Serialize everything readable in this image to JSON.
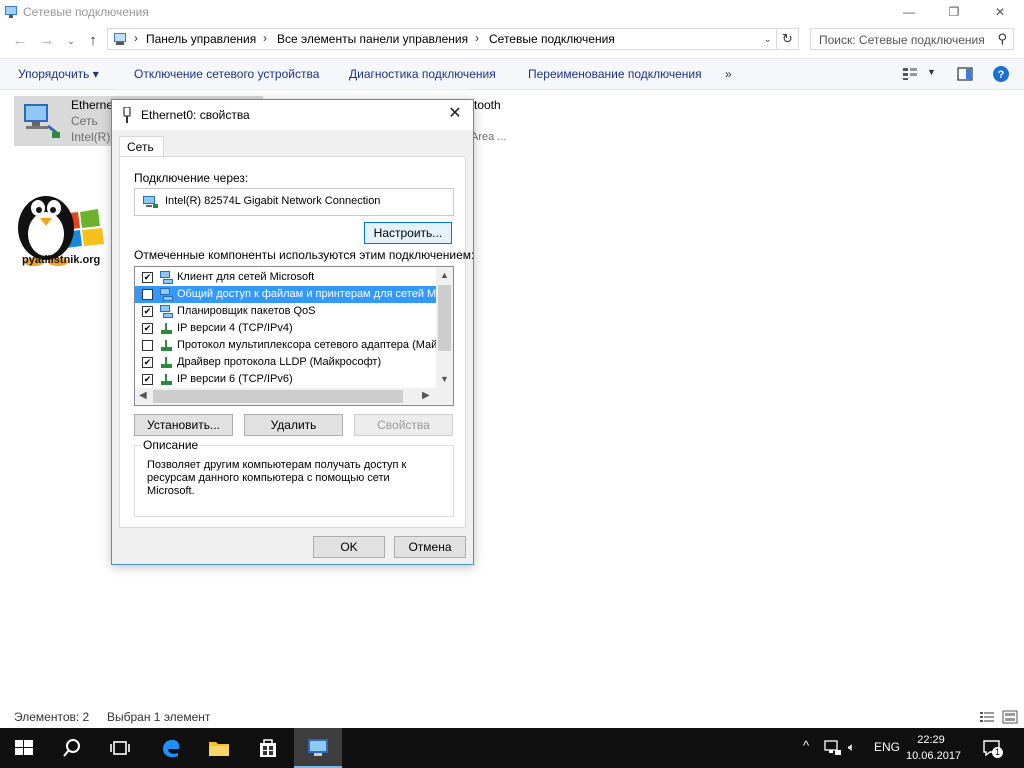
{
  "window": {
    "title": "Сетевые подключения",
    "minimize": "—",
    "maximize": "❐",
    "close": "✕"
  },
  "address": {
    "crumbs": [
      "Панель управления",
      "Все элементы панели управления",
      "Сетевые подключения"
    ],
    "search_placeholder": "Поиск: Сетевые подключения"
  },
  "commands": {
    "organize": "Упорядочить ▾",
    "disable": "Отключение сетевого устройства",
    "diagnose": "Диагностика подключения",
    "rename": "Переименование подключения",
    "more": "»"
  },
  "items": {
    "ethernet": {
      "name": "Etherne",
      "status": "Сеть",
      "device": "Intel(R)"
    },
    "bluetooth": {
      "name": "tooth",
      "device": "Area ..."
    }
  },
  "logo_text": "pyatilistnik.org",
  "statusbar": {
    "count": "Элементов: 2",
    "selected": "Выбран 1 элемент"
  },
  "dialog": {
    "title": "Ethernet0: свойства",
    "tab": "Сеть",
    "connect_using_label": "Подключение через:",
    "adapter": "Intel(R) 82574L Gigabit Network Connection",
    "configure": "Настроить...",
    "components_label": "Отмеченные компоненты используются этим подключением:",
    "components": [
      {
        "label": "Клиент для сетей Microsoft",
        "checked": true,
        "selected": false
      },
      {
        "label": "Общий доступ к файлам и принтерам для сетей Mi",
        "checked": false,
        "selected": true
      },
      {
        "label": "Планировщик пакетов QoS",
        "checked": true,
        "selected": false
      },
      {
        "label": "IP версии 4 (TCP/IPv4)",
        "checked": true,
        "selected": false
      },
      {
        "label": "Протокол мультиплексора сетевого адаптера (Май",
        "checked": false,
        "selected": false
      },
      {
        "label": "Драйвер протокола LLDP (Майкрософт)",
        "checked": true,
        "selected": false
      },
      {
        "label": "IP версии 6 (TCP/IPv6)",
        "checked": true,
        "selected": false
      }
    ],
    "install": "Установить...",
    "uninstall": "Удалить",
    "properties": "Свойства",
    "description_legend": "Описание",
    "description": "Позволяет другим компьютерам получать доступ к ресурсам данного компьютера с помощью сети Microsoft.",
    "ok": "OK",
    "cancel": "Отмена"
  },
  "taskbar": {
    "lang": "ENG",
    "time": "22:29",
    "date": "10.06.2017",
    "notifications": "1"
  }
}
